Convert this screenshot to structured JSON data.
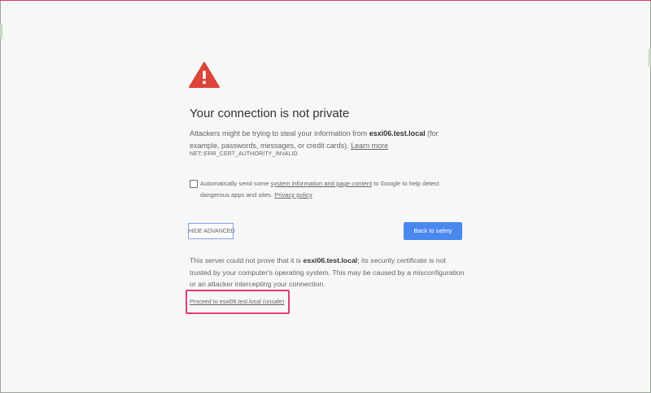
{
  "title": "Your connection is not private",
  "description": {
    "before_host": "Attackers might be trying to steal your information from ",
    "host": "esxi06.test.local",
    "after_host": " (for example, passwords, messages, or credit cards). ",
    "learn_more": "Learn more"
  },
  "error_code": "NET::ERR_CERT_AUTHORITY_INVALID",
  "checkbox": {
    "text_before": "Automatically send some ",
    "link_system_info": "system information and page content",
    "text_middle": " to Google to help detect dangerous apps and sites. ",
    "link_privacy": "Privacy policy",
    "checked": false
  },
  "buttons": {
    "hide_advanced": "HIDE ADVANCED",
    "back_to_safety": "Back to safety"
  },
  "details": {
    "before_host": "This server could not prove that it is ",
    "host": "esxi06.test.local",
    "after_host": "; its security certificate is not trusted by your computer's operating system. This may be caused by a misconfiguration or an attacker intercepting your connection."
  },
  "proceed_link": "Proceed to esxi06.test.local (unsafe)",
  "colors": {
    "warning_red": "#db4437",
    "primary_blue": "#4a87ee",
    "highlight_pink": "#e03d71"
  },
  "icons": {
    "warning": "warning-triangle-icon"
  }
}
